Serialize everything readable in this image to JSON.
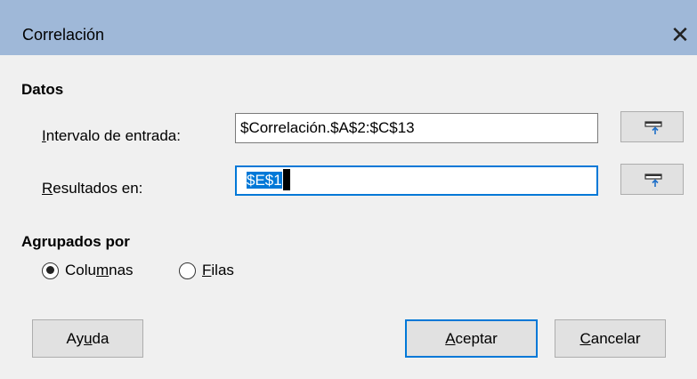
{
  "window": {
    "title": "Correlación"
  },
  "datos": {
    "heading": "Datos",
    "input_range": {
      "label_ul": "I",
      "label_rest": "ntervalo de entrada:",
      "value": "$Correlación.$A$2:$C$13"
    },
    "results": {
      "label_ul": "R",
      "label_rest": "esultados en:",
      "value": "$E$1"
    }
  },
  "grouped": {
    "heading": "Agrupados por",
    "columns": {
      "pre": "Colu",
      "ul": "m",
      "post": "nas",
      "checked": true
    },
    "rows": {
      "ul": "F",
      "post": "ilas",
      "checked": false
    }
  },
  "buttons": {
    "help": {
      "pre": "Ay",
      "ul": "u",
      "post": "da"
    },
    "ok": {
      "ul": "A",
      "post": "ceptar"
    },
    "cancel": {
      "ul": "C",
      "post": "ancelar"
    }
  },
  "colors": {
    "titlebar": "#9fb8d8",
    "accent": "#0078d7"
  },
  "icons": {
    "close": "close-icon",
    "shrink": "shrink-dialog-icon"
  }
}
